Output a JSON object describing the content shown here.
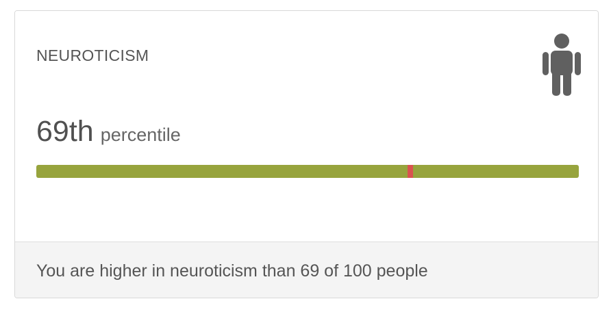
{
  "card": {
    "title": "NEUROTICISM",
    "icon": "person-icon",
    "percentile_value": "69th",
    "percentile_unit": "percentile",
    "percentile_fraction": 0.69,
    "footer_text": "You are higher in neuroticism than 69 of 100 people"
  },
  "colors": {
    "bar": "#97a43d",
    "marker": "#d9534f",
    "icon": "#606060",
    "footer_bg": "#f4f4f4"
  }
}
